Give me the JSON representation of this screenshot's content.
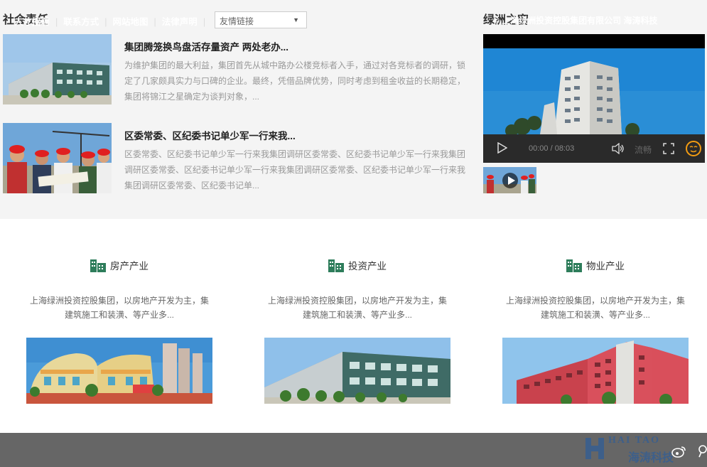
{
  "social": {
    "title": "社会责任",
    "news": [
      {
        "title": "集团腾笼换鸟盘活存量资产 两处老办...",
        "body": "为维护集团的最大利益，集团首先从城中路办公楼竞标者入手，通过对各竞标者的调研，锁定了几家颇具实力与口碑的企业。最终，凭借品牌优势，同时考虑到租金收益的长期稳定，集团将锦江之星确定为谈判对象，..."
      },
      {
        "title": "区委常委、区纪委书记单少军一行来我...",
        "body": "区委常委、区纪委书记单少军一行来我集团调研区委常委、区纪委书记单少军一行来我集团调研区委常委、区纪委书记单少军一行来我集团调研区委常委、区纪委书记单少军一行来我集团调研区委常委、区纪委书记单..."
      }
    ]
  },
  "oasis": {
    "title": "绿洲之窗",
    "video": {
      "time": "00:00 / 08:03",
      "quality": "流畅"
    }
  },
  "industries": [
    {
      "title": "房产产业",
      "desc": "上海绿洲投资控股集团，以房地产开发为主，集建筑施工和装潢、等产业多..."
    },
    {
      "title": "投资产业",
      "desc": "上海绿洲投资控股集团，以房地产开发为主，集建筑施工和装潢、等产业多..."
    },
    {
      "title": "物业产业",
      "desc": "上海绿洲投资控股集团，以房地产开发为主，集建筑施工和装潢、等产业多..."
    }
  ],
  "footer": {
    "links": [
      "人才招聘",
      "联系方式",
      "网站地图",
      "法律声明"
    ],
    "select_value": "友情链接",
    "copyright": "© 上海绿洲投资控股集团有限公司",
    "credit": "海涛科技",
    "watermark_en": "HAI TAO",
    "watermark_cn": "海涛科技"
  },
  "colors": {
    "band": "#f4f4f4",
    "footer": "#666666",
    "icon_green": "#2e7d5b",
    "player_accent": "#f39c12"
  }
}
